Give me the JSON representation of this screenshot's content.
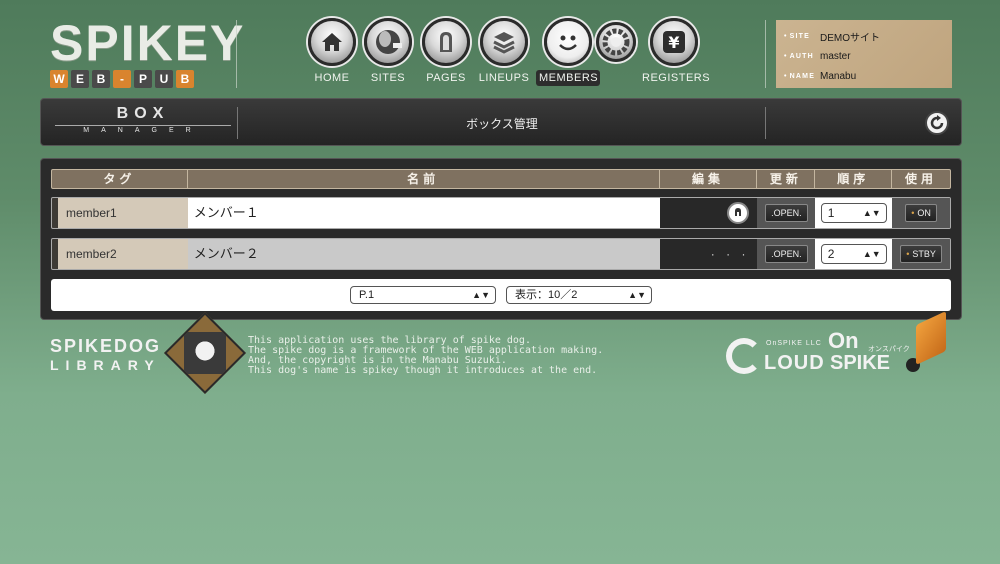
{
  "logo": {
    "title": "SPIKEY",
    "sub": [
      "W",
      "E",
      "B",
      "-",
      "P",
      "U",
      "B"
    ],
    "sub_colors": [
      "#d9842e",
      "#4a4a4a",
      "#4a4a4a",
      "#d9842e",
      "#4a4a4a",
      "#4a4a4a",
      "#d9842e"
    ]
  },
  "nav": [
    {
      "label": "HOME",
      "icon": "home-icon"
    },
    {
      "label": "SITES",
      "icon": "globe-icon"
    },
    {
      "label": "PAGES",
      "icon": "pages-icon"
    },
    {
      "label": "LINEUPS",
      "icon": "stack-icon"
    },
    {
      "label": "MEMBERS",
      "icon": "smiley-icon",
      "active": true
    },
    {
      "label": "",
      "icon": "gear-icon"
    },
    {
      "label": "REGISTERS",
      "icon": "yen-icon"
    }
  ],
  "info": {
    "site_key": "SITE",
    "site_value": "DEMOサイト",
    "auth_key": "AUTH",
    "auth_value": "master",
    "name_key": "NAME",
    "name_value": "Manabu"
  },
  "titlebar": {
    "box_line1": "BOX",
    "box_line2": "MANAGER",
    "page_title": "ボックス管理"
  },
  "table": {
    "headers": [
      "タグ",
      "名前",
      "編集",
      "更新",
      "順序",
      "使用"
    ],
    "rows": [
      {
        "tag": "member1",
        "name": "メンバー１",
        "edit": "",
        "update": ".OPEN.",
        "order": "1",
        "use": "ON"
      },
      {
        "tag": "member2",
        "name": "メンバー２",
        "edit": "· · ·",
        "update": ".OPEN.",
        "order": "2",
        "use": "STBY"
      }
    ]
  },
  "pager": {
    "page": "P.1",
    "display": "表示：10／2"
  },
  "footer": {
    "lib_line1": "SPIKEDOG",
    "lib_line2": "LIBRARY",
    "text": [
      "This application uses the library of spike dog.",
      "The spike dog is a framework of the WEB application making.",
      "And, the copyright is in the Manabu Suzuki.",
      "This dog's name is spikey though it introduces at the end."
    ],
    "cloud_small": "OnSPIKE LLC",
    "cloud_big": "LOUD",
    "cloud_on": "On",
    "cloud_kana": "オンスパイク",
    "cloud_spike": "SPIKE"
  }
}
